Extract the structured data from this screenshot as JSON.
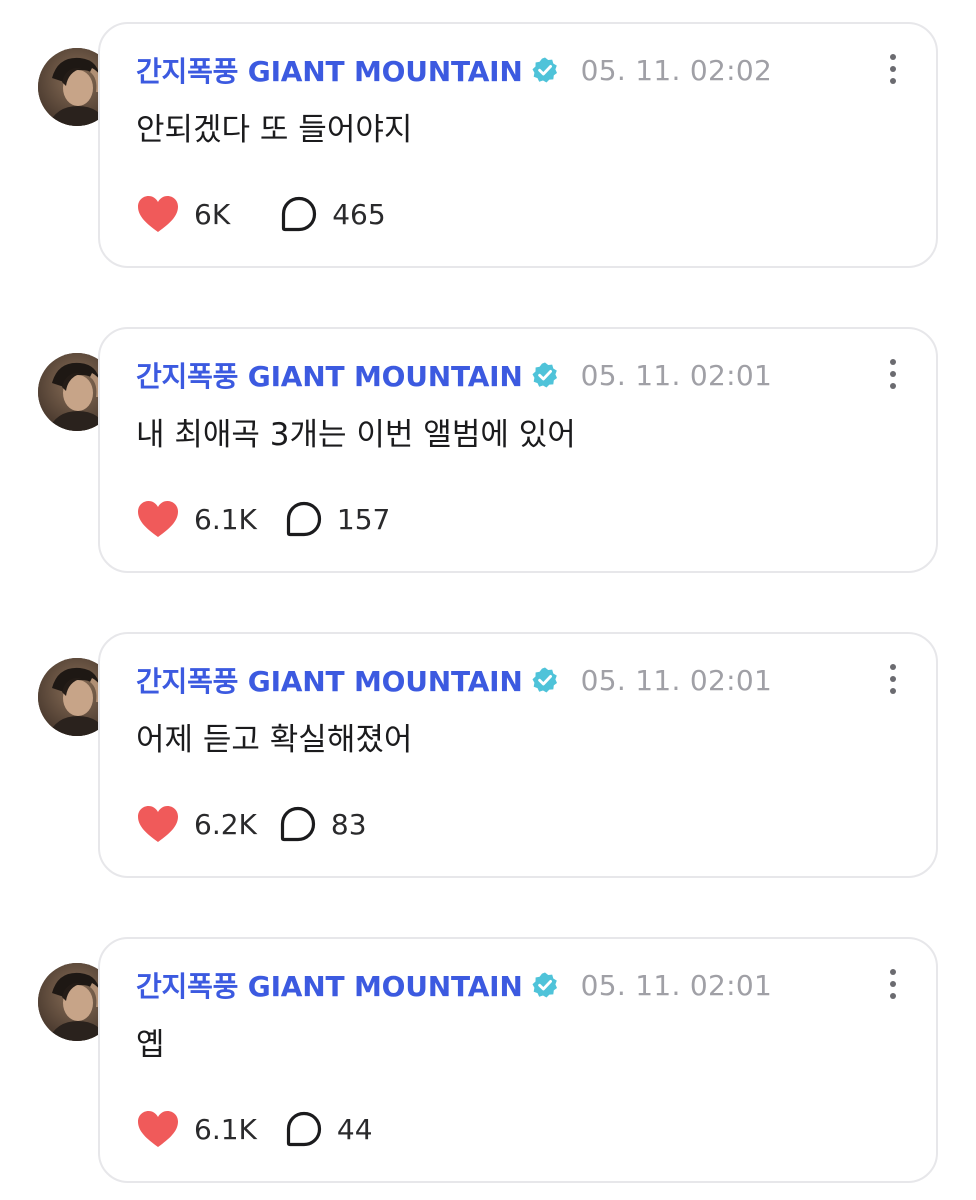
{
  "colors": {
    "name": "#3c5ae0",
    "verified": "#4fc3d9",
    "heart": "#f05a5a",
    "timestamp": "#a0a0a6",
    "card_border": "#e7e7ea"
  },
  "icons": {
    "verified": "verified-badge-icon",
    "like": "heart-icon",
    "comment": "speech-bubble-icon",
    "menu": "vertical-dots-icon"
  },
  "posts": [
    {
      "author": "간지폭풍 GIANT MOUNTAIN",
      "timestamp": "05. 11. 02:02",
      "text": "안되겠다 또 들어야지",
      "likes": "6K",
      "comments": "465"
    },
    {
      "author": "간지폭풍 GIANT MOUNTAIN",
      "timestamp": "05. 11. 02:01",
      "text": "내 최애곡 3개는 이번 앨범에 있어",
      "likes": "6.1K",
      "comments": "157"
    },
    {
      "author": "간지폭풍 GIANT MOUNTAIN",
      "timestamp": "05. 11. 02:01",
      "text": "어제 듣고 확실해졌어",
      "likes": "6.2K",
      "comments": "83"
    },
    {
      "author": "간지폭풍 GIANT MOUNTAIN",
      "timestamp": "05. 11. 02:01",
      "text": "옙",
      "likes": "6.1K",
      "comments": "44"
    }
  ]
}
